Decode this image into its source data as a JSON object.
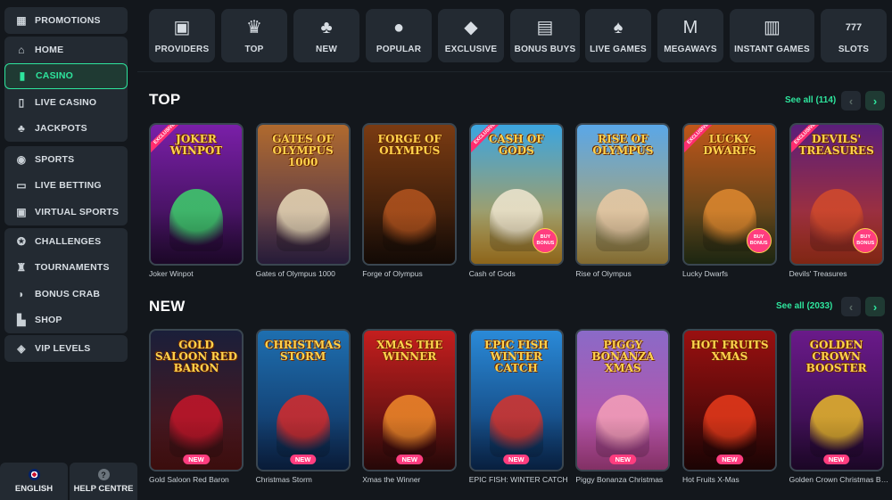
{
  "sidebar": {
    "groups": [
      [
        {
          "label": "PROMOTIONS",
          "icon": "gift-icon"
        }
      ],
      [
        {
          "label": "HOME",
          "icon": "home-icon"
        },
        {
          "label": "CASINO",
          "icon": "casino-icon",
          "active": true
        },
        {
          "label": "LIVE CASINO",
          "icon": "cards-icon"
        },
        {
          "label": "JACKPOTS",
          "icon": "clover-icon"
        }
      ],
      [
        {
          "label": "SPORTS",
          "icon": "ball-icon"
        },
        {
          "label": "LIVE BETTING",
          "icon": "live-icon"
        },
        {
          "label": "VIRTUAL SPORTS",
          "icon": "tv-icon"
        }
      ],
      [
        {
          "label": "CHALLENGES",
          "icon": "medal-icon"
        },
        {
          "label": "TOURNAMENTS",
          "icon": "trophy-icon"
        },
        {
          "label": "BONUS CRAB",
          "icon": "crab-icon"
        },
        {
          "label": "SHOP",
          "icon": "basket-icon"
        }
      ],
      [
        {
          "label": "VIP LEVELS",
          "icon": "diamond-icon"
        }
      ]
    ],
    "bottom": {
      "language": "ENGLISH",
      "help": "HELP CENTRE",
      "help_glyph": "?"
    }
  },
  "categories": [
    {
      "label": "PROVIDERS",
      "icon": "book-icon",
      "glyph": "▣"
    },
    {
      "label": "TOP",
      "icon": "crown-icon",
      "glyph": "♛"
    },
    {
      "label": "NEW",
      "icon": "clover-icon",
      "glyph": "♣"
    },
    {
      "label": "POPULAR",
      "icon": "bomb-icon",
      "glyph": "●"
    },
    {
      "label": "EXCLUSIVE",
      "icon": "gem-icon",
      "glyph": "◆"
    },
    {
      "label": "BONUS BUYS",
      "icon": "gift-icon",
      "glyph": "▤"
    },
    {
      "label": "LIVE GAMES",
      "icon": "cards-icon",
      "glyph": "♠"
    },
    {
      "label": "MEGAWAYS",
      "icon": "megaways-icon",
      "glyph": "M"
    },
    {
      "label": "INSTANT GAMES",
      "icon": "mug-icon",
      "glyph": "▥"
    },
    {
      "label": "SLOTS",
      "icon": "slot-machine-icon",
      "glyph": "777"
    }
  ],
  "sections": {
    "top": {
      "title": "TOP",
      "see_all": "See all (114)",
      "games": [
        {
          "name": "Joker Winpot",
          "art": "JOKER WINPOT",
          "c1": "#7a1fa8",
          "c2": "#2b0c3d",
          "fig": "#3dd16b",
          "corner": "EXCLUSIVE"
        },
        {
          "name": "Gates of Olympus 1000",
          "art": "GATES OF OLYMPUS 1000",
          "c1": "#b06a2e",
          "c2": "#3b2a55",
          "fig": "#e8d9b8"
        },
        {
          "name": "Forge of Olympus",
          "art": "FORGE OF OLYMPUS",
          "c1": "#7a3b12",
          "c2": "#1d0f08",
          "fig": "#b3541e"
        },
        {
          "name": "Cash of Gods",
          "art": "CASH OF GODS",
          "c1": "#3ba5e0",
          "c2": "#d79b2a",
          "fig": "#f0e6d0",
          "corner": "EXCLUSIVE",
          "bonus": "BUY BONUS"
        },
        {
          "name": "Rise of Olympus",
          "art": "RISE OF OLYMPUS",
          "c1": "#5aa7e8",
          "c2": "#c7a24a",
          "fig": "#e9c9a5"
        },
        {
          "name": "Lucky Dwarfs",
          "art": "LUCKY DWARFS",
          "c1": "#c0561a",
          "c2": "#2d3a1a",
          "fig": "#e0892f",
          "corner": "EXCLUSIVE",
          "bonus": "BUY BONUS"
        },
        {
          "name": "Devils' Treasures",
          "art": "DEVILS' TREASURES",
          "c1": "#5a1e7a",
          "c2": "#c23a1e",
          "fig": "#d24a2b",
          "corner": "EXCLUSIVE",
          "bonus": "BUY BONUS"
        }
      ]
    },
    "new": {
      "title": "NEW",
      "see_all": "See all (2033)",
      "games": [
        {
          "name": "Gold Saloon Red Baron",
          "art": "GOLD SALOON RED BARON",
          "c1": "#1a1f3a",
          "c2": "#5a1414",
          "fig": "#c4162a",
          "badge": "NEW"
        },
        {
          "name": "Christmas Storm",
          "art": "CHRISTMAS STORM",
          "c1": "#1e6fb0",
          "c2": "#0e2a55",
          "fig": "#d82a2a",
          "badge": "NEW"
        },
        {
          "name": "Xmas the Winner",
          "art": "XMAS THE WINNER",
          "c1": "#c41e1e",
          "c2": "#3a0c0c",
          "fig": "#f08a2a",
          "badge": "NEW"
        },
        {
          "name": "EPIC FISH: WINTER CATCH",
          "art": "EPIC FISH WINTER CATCH",
          "c1": "#2a8ad8",
          "c2": "#0c3060",
          "fig": "#d8322a",
          "badge": "NEW"
        },
        {
          "name": "Piggy Bonanza Christmas",
          "art": "PIGGY BONANZA XMAS",
          "c1": "#8a6ac8",
          "c2": "#c84a9a",
          "fig": "#f5a0b8",
          "badge": "NEW"
        },
        {
          "name": "Hot Fruits X-Mas",
          "art": "HOT FRUITS XMAS",
          "c1": "#9a1010",
          "c2": "#2a0606",
          "fig": "#e83a1a",
          "badge": "NEW"
        },
        {
          "name": "Golden Crown Christmas Booster",
          "art": "GOLDEN CROWN BOOSTER",
          "c1": "#6a1a8a",
          "c2": "#2a0a3a",
          "fig": "#e8b82a",
          "badge": "NEW"
        }
      ]
    }
  }
}
